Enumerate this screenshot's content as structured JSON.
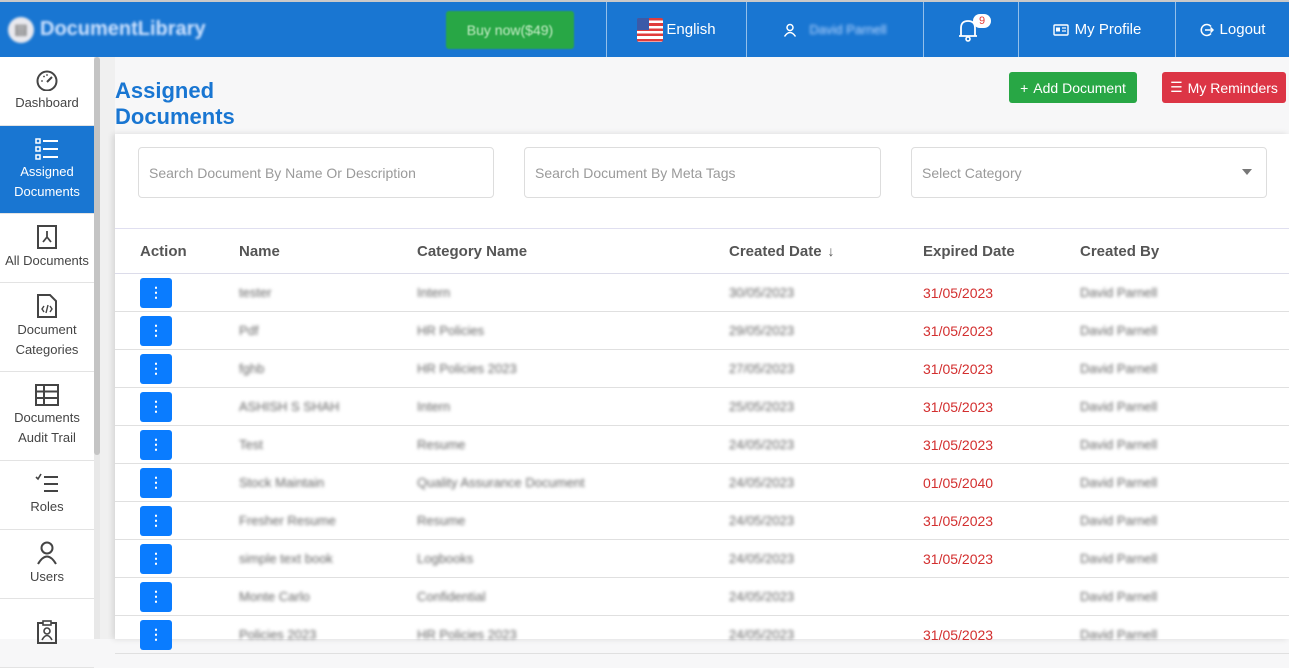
{
  "header": {
    "logo_text": "DocumentLibrary",
    "buy_label": "Buy now($49)",
    "language": "English",
    "user_name": "David Parnell",
    "notification_count": "9",
    "profile_label": "My Profile",
    "logout_label": "Logout"
  },
  "sidebar": {
    "items": [
      {
        "label": "Dashboard",
        "icon": "speedometer-icon"
      },
      {
        "label": "Assigned Documents",
        "icon": "list-icon",
        "active": true
      },
      {
        "label": "All Documents",
        "icon": "pdf-file-icon"
      },
      {
        "label": "Document Categories",
        "icon": "code-file-icon"
      },
      {
        "label": "Documents Audit Trail",
        "icon": "table-icon"
      },
      {
        "label": "Roles",
        "icon": "checklist-icon"
      },
      {
        "label": "Users",
        "icon": "user-icon"
      },
      {
        "label": "",
        "icon": "clipboard-user-icon"
      }
    ]
  },
  "main": {
    "title": "Assigned Documents",
    "add_button": "Add Document",
    "reminders_button": "My Reminders",
    "filters": {
      "search_name_placeholder": "Search Document By Name Or Description",
      "search_meta_placeholder": "Search Document By Meta Tags",
      "category_placeholder": "Select Category"
    },
    "table": {
      "columns": [
        "Action",
        "Name",
        "Category Name",
        "Created Date",
        "Expired Date",
        "Created By"
      ],
      "sort_indicator": "↓",
      "rows": [
        {
          "name": "tester",
          "category": "Intern",
          "created": "30/05/2023",
          "expired": "31/05/2023",
          "created_by": "David Parnell"
        },
        {
          "name": "Pdf",
          "category": "HR Policies",
          "created": "29/05/2023",
          "expired": "31/05/2023",
          "created_by": "David Parnell"
        },
        {
          "name": "fghb",
          "category": "HR Policies 2023",
          "created": "27/05/2023",
          "expired": "31/05/2023",
          "created_by": "David Parnell"
        },
        {
          "name": "ASHISH S SHAH",
          "category": "Intern",
          "created": "25/05/2023",
          "expired": "31/05/2023",
          "created_by": "David Parnell"
        },
        {
          "name": "Test",
          "category": "Resume",
          "created": "24/05/2023",
          "expired": "31/05/2023",
          "created_by": "David Parnell"
        },
        {
          "name": "Stock Maintain",
          "category": "Quality Assurance Document",
          "created": "24/05/2023",
          "expired": "01/05/2040",
          "created_by": "David Parnell"
        },
        {
          "name": "Fresher Resume",
          "category": "Resume",
          "created": "24/05/2023",
          "expired": "31/05/2023",
          "created_by": "David Parnell"
        },
        {
          "name": "simple text book",
          "category": "Logbooks",
          "created": "24/05/2023",
          "expired": "31/05/2023",
          "created_by": "David Parnell"
        },
        {
          "name": "Monte Carlo",
          "category": "Confidential",
          "created": "24/05/2023",
          "expired": "",
          "created_by": "David Parnell"
        },
        {
          "name": "Policies 2023",
          "category": "HR Policies 2023",
          "created": "24/05/2023",
          "expired": "31/05/2023",
          "created_by": "David Parnell"
        }
      ]
    }
  },
  "colors": {
    "primary": "#1976d2",
    "success": "#28a745",
    "danger": "#dc3545",
    "action_button": "#0a7cff",
    "expired_text": "#d32f2f"
  }
}
